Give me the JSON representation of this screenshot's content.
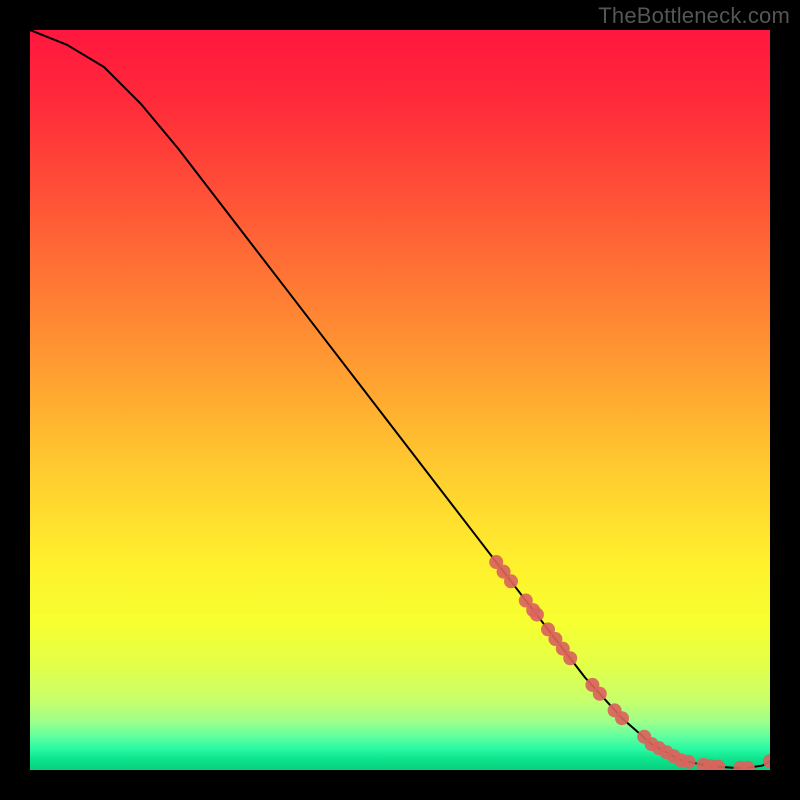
{
  "watermark": "TheBottleneck.com",
  "chart_data": {
    "type": "line",
    "title": "",
    "xlabel": "",
    "ylabel": "",
    "xlim": [
      0,
      100
    ],
    "ylim": [
      0,
      100
    ],
    "curve": {
      "x": [
        0,
        5,
        10,
        15,
        20,
        25,
        30,
        35,
        40,
        45,
        50,
        55,
        60,
        65,
        70,
        75,
        80,
        84,
        88,
        92,
        95,
        97,
        99,
        100
      ],
      "y": [
        100,
        98,
        95,
        90,
        84,
        77.5,
        71,
        64.5,
        58,
        51.5,
        45,
        38.5,
        32,
        25.5,
        19,
        12.5,
        7,
        3.5,
        1.3,
        0.5,
        0.3,
        0.3,
        0.6,
        1.2
      ]
    },
    "markers": {
      "x": [
        63,
        64,
        65,
        67,
        68,
        68.5,
        70,
        71,
        72,
        73,
        76,
        77,
        79,
        80,
        83,
        84,
        85,
        86,
        87,
        88,
        89,
        91,
        92,
        93,
        96,
        97,
        100
      ],
      "y": [
        28.1,
        26.8,
        25.5,
        22.9,
        21.6,
        21.0,
        19,
        17.7,
        16.4,
        15.1,
        11.5,
        10.3,
        8.05,
        7,
        4.5,
        3.5,
        2.95,
        2.4,
        1.85,
        1.3,
        1.1,
        0.7,
        0.5,
        0.45,
        0.3,
        0.3,
        1.2
      ]
    },
    "marker_color": "#d9645c",
    "gradient_stops": [
      {
        "offset": 0.0,
        "color": "#ff173e"
      },
      {
        "offset": 0.1,
        "color": "#ff2b3a"
      },
      {
        "offset": 0.22,
        "color": "#ff5037"
      },
      {
        "offset": 0.35,
        "color": "#ff7a34"
      },
      {
        "offset": 0.48,
        "color": "#ffa431"
      },
      {
        "offset": 0.6,
        "color": "#ffcd2f"
      },
      {
        "offset": 0.72,
        "color": "#fff02d"
      },
      {
        "offset": 0.8,
        "color": "#f7ff2f"
      },
      {
        "offset": 0.86,
        "color": "#e2ff4a"
      },
      {
        "offset": 0.905,
        "color": "#c8ff6a"
      },
      {
        "offset": 0.935,
        "color": "#9dff8a"
      },
      {
        "offset": 0.955,
        "color": "#5fffa0"
      },
      {
        "offset": 0.972,
        "color": "#28f8a2"
      },
      {
        "offset": 0.985,
        "color": "#0de48d"
      },
      {
        "offset": 1.0,
        "color": "#06d07d"
      }
    ]
  }
}
